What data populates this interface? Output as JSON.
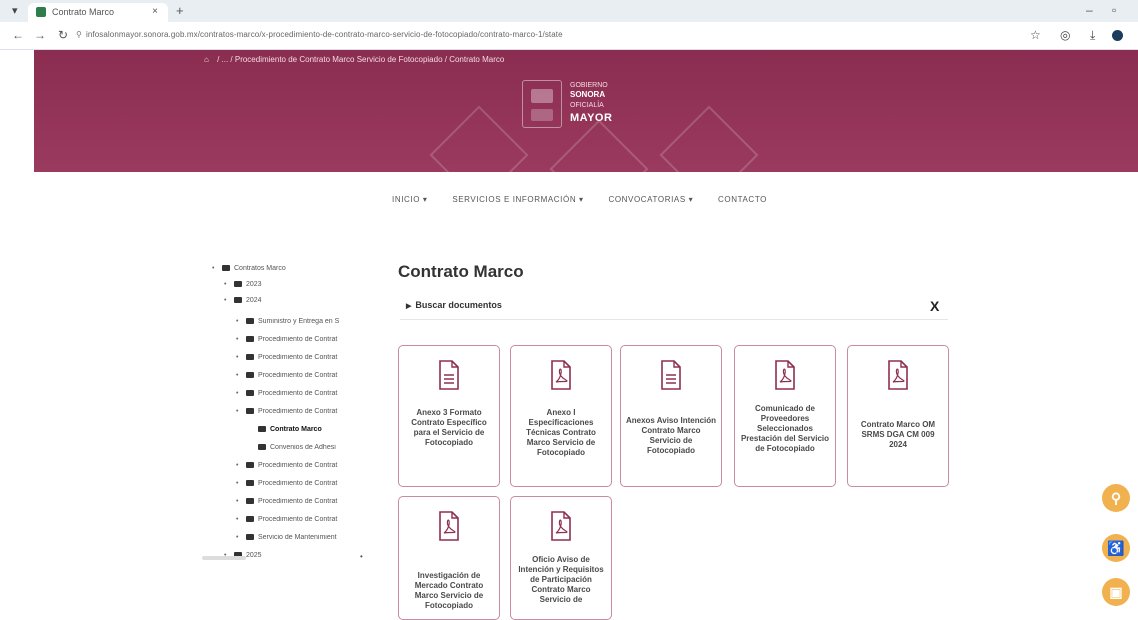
{
  "browser": {
    "tab_title": "Contrato Marco",
    "tab_close": "×",
    "new_tab": "+",
    "url": "infosalonmayor.sonora.gob.mx/contratos-marco/x-procedimiento-de-contrato-marco-servicio-de-fotocopiado/contrato-marco-1/state"
  },
  "banner": {
    "breadcrumb_home": "⌂",
    "breadcrumb_trail": "/ ... / Procedimiento de Contrato Marco Servicio de Fotocopiado / Contrato Marco",
    "logo_line1": "GOBIERNO",
    "logo_line2": "SONORA",
    "logo_line3": "OFICIALÍA",
    "logo_line4": "MAYOR"
  },
  "nav": {
    "items": [
      "INICIO ▾",
      "SERVICIOS E INFORMACIÓN ▾",
      "CONVOCATORIAS ▾",
      "CONTACTO"
    ]
  },
  "tree": {
    "items": [
      {
        "label": "Contratos Marco"
      },
      {
        "label": "2023"
      },
      {
        "label": "2024"
      },
      {
        "label": "Suministro y Entrega en S"
      },
      {
        "label": "Procedimiento de Contrat"
      },
      {
        "label": "Procedimiento de Contrat"
      },
      {
        "label": "Procedimiento de Contrat"
      },
      {
        "label": "Procedimiento de Contrat"
      },
      {
        "label": "Procedimiento de Contrat"
      },
      {
        "label": "Contrato Marco"
      },
      {
        "label": "Convenios de Adhesi"
      },
      {
        "label": "Procedimiento de Contrat"
      },
      {
        "label": "Procedimiento de Contrat"
      },
      {
        "label": "Procedimiento de Contrat"
      },
      {
        "label": "Procedimiento de Contrat"
      },
      {
        "label": "Servicio de Mantenimient"
      },
      {
        "label": "2025"
      }
    ]
  },
  "content": {
    "title": "Contrato Marco",
    "search_label": "Buscar documentos",
    "search_close": "X"
  },
  "documents": [
    {
      "type": "doc",
      "label": "Anexo 3 Formato Contrato Específico para el Servicio de Fotocopiado"
    },
    {
      "type": "pdf",
      "label": "Anexo I Especificaciones Técnicas Contrato Marco Servicio de Fotocopiado"
    },
    {
      "type": "doc",
      "label": "Anexos Aviso Intención Contrato Marco Servicio de Fotocopiado"
    },
    {
      "type": "pdf",
      "label": "Comunicado de Proveedores Seleccionados Prestación del Servicio de Fotocopiado"
    },
    {
      "type": "pdf",
      "label": "Contrato Marco OM SRMS DGA CM 009 2024"
    },
    {
      "type": "pdf",
      "label": "Investigación de Mercado Contrato Marco Servicio de Fotocopiado"
    },
    {
      "type": "pdf",
      "label": "Oficio Aviso de Intención y Requisitos de Participación Contrato Marco Servicio de"
    }
  ],
  "colors": {
    "banner": "#8e2f52",
    "card_border": "#c98aa3",
    "fab": "#f0b14e"
  }
}
